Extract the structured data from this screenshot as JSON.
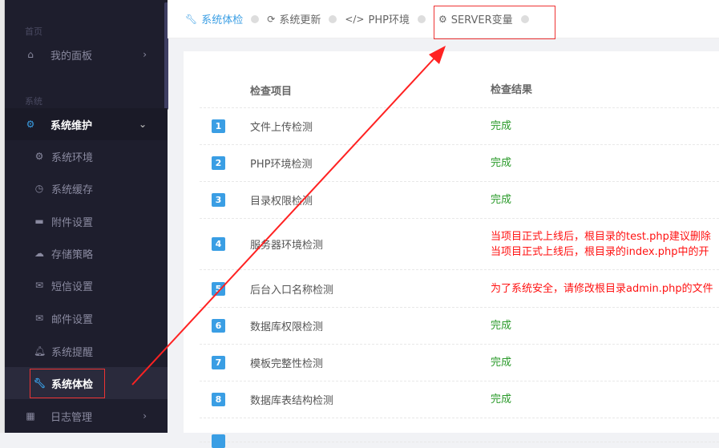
{
  "sidebar": {
    "sections": [
      "首页",
      "系统"
    ],
    "items": [
      {
        "label": "我的面板",
        "icon": "home-icon"
      },
      {
        "label": "系统维护",
        "icon": "gear-icon"
      },
      {
        "label": "系统环境",
        "icon": "gear-icon"
      },
      {
        "label": "系统缓存",
        "icon": "clock-icon"
      },
      {
        "label": "附件设置",
        "icon": "folder-icon"
      },
      {
        "label": "存储策略",
        "icon": "cloud-icon"
      },
      {
        "label": "短信设置",
        "icon": "envelope-icon"
      },
      {
        "label": "邮件设置",
        "icon": "envelope-open-icon"
      },
      {
        "label": "系统提醒",
        "icon": "bell-icon"
      },
      {
        "label": "系统体检",
        "icon": "wrench-icon"
      },
      {
        "label": "日志管理",
        "icon": "calendar-icon"
      }
    ]
  },
  "tabs": [
    {
      "label": "系统体检",
      "icon": "wrench-icon"
    },
    {
      "label": "系统更新",
      "icon": "refresh-icon"
    },
    {
      "label": "PHP环境",
      "icon": "code-icon"
    },
    {
      "label": "SERVER变量",
      "icon": "gear-icon"
    }
  ],
  "table": {
    "headers": [
      "检查项目",
      "检查结果"
    ],
    "rows": [
      {
        "n": "1",
        "name": "文件上传检测",
        "result": [
          "完成"
        ],
        "status": "ok"
      },
      {
        "n": "2",
        "name": "PHP环境检测",
        "result": [
          "完成"
        ],
        "status": "ok"
      },
      {
        "n": "3",
        "name": "目录权限检测",
        "result": [
          "完成"
        ],
        "status": "ok"
      },
      {
        "n": "4",
        "name": "服务器环境检测",
        "result": [
          "当项目正式上线后，根目录的test.php建议删除",
          "当项目正式上线后，根目录的index.php中的开"
        ],
        "status": "bad"
      },
      {
        "n": "5",
        "name": "后台入口名称检测",
        "result": [
          "为了系统安全，请修改根目录admin.php的文件"
        ],
        "status": "bad"
      },
      {
        "n": "6",
        "name": "数据库权限检测",
        "result": [
          "完成"
        ],
        "status": "ok"
      },
      {
        "n": "7",
        "name": "模板完整性检测",
        "result": [
          "完成"
        ],
        "status": "ok"
      },
      {
        "n": "8",
        "name": "数据库表结构检测",
        "result": [
          "完成"
        ],
        "status": "ok"
      }
    ]
  },
  "colors": {
    "accent": "#3a9ee4",
    "ok": "#2a9a2a",
    "error": "#ff1111",
    "sidebar": "#1e1e2d"
  }
}
